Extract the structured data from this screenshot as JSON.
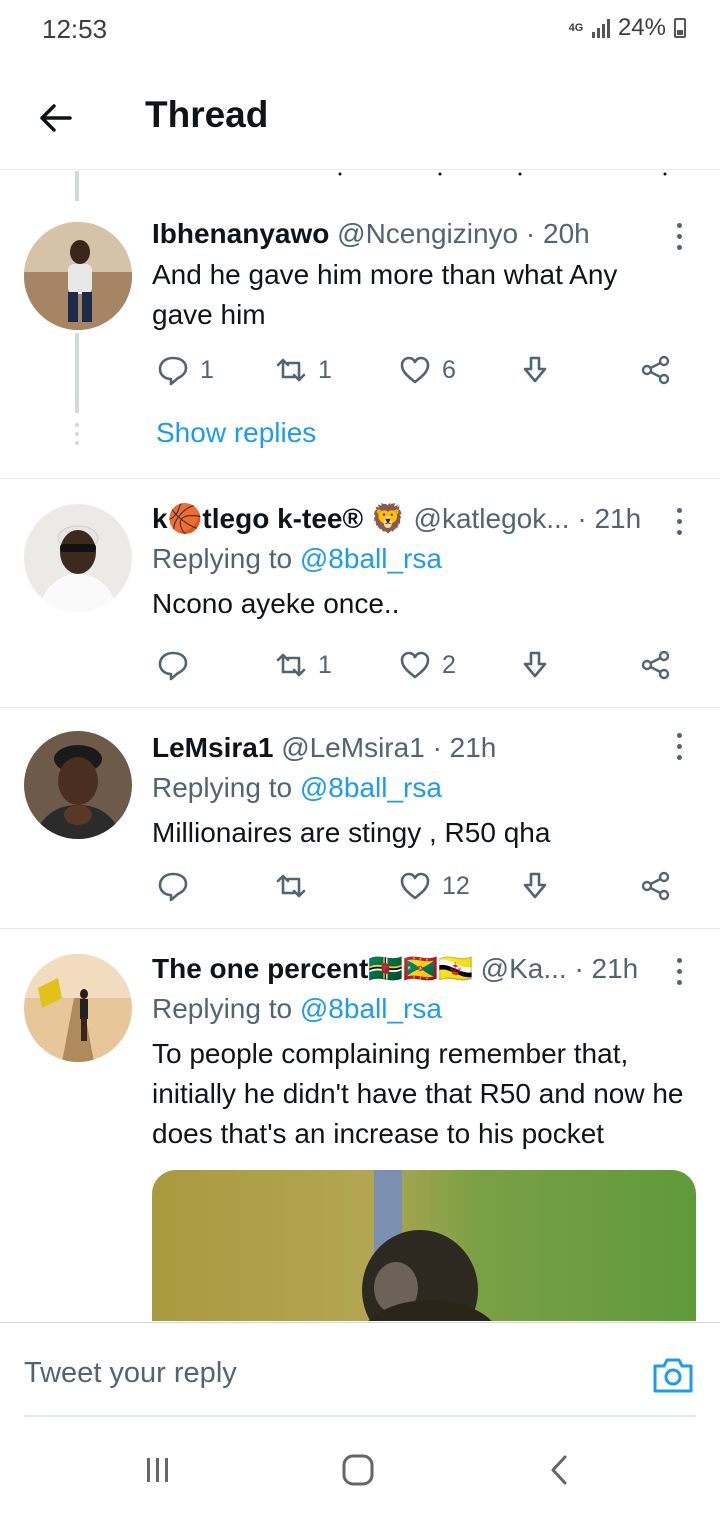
{
  "status_bar": {
    "time": "12:53",
    "network": "4G",
    "battery": "24%"
  },
  "header": {
    "title": "Thread"
  },
  "tweets": [
    {
      "name": "Ibhenanyawo",
      "handle": "@Ncengizinyo",
      "time": "· 20h",
      "replying_prefix": "",
      "replying_to": "",
      "text": "And he gave him more than what Any gave him",
      "replies": "1",
      "retweets": "1",
      "likes": "6",
      "show_replies": "Show replies"
    },
    {
      "name": "k🏀tlego k-tee® 🦁",
      "handle": "@katlegok...",
      "time": "· 21h",
      "replying_prefix": "Replying to",
      "replying_to": "@8ball_rsa",
      "text": "Ncono ayeke once..",
      "replies": "",
      "retweets": "1",
      "likes": "2"
    },
    {
      "name": "LeMsira1",
      "handle": "@LeMsira1",
      "time": "· 21h",
      "replying_prefix": "Replying to",
      "replying_to": "@8ball_rsa",
      "text": "Millionaires are stingy , R50 qha",
      "replies": "",
      "retweets": "",
      "likes": "12"
    },
    {
      "name": "The one percent🇩🇲🇬🇩🇧🇳",
      "handle": "@Ka...",
      "time": "· 21h",
      "replying_prefix": "Replying to",
      "replying_to": "@8ball_rsa",
      "text": "To people complaining remember that, initially he didn't have that R50 and now he does that's an increase to his pocket"
    }
  ],
  "reply_bar": {
    "placeholder": "Tweet your reply"
  },
  "colors": {
    "accent": "#1d9bf0",
    "text": "#0f1419",
    "secondary": "#536471",
    "divider": "#e6ecf0"
  },
  "icons": [
    "back-arrow-icon",
    "more-vertical-icon",
    "reply-icon",
    "retweet-icon",
    "like-icon",
    "download-icon",
    "share-icon",
    "camera-icon",
    "recents-icon",
    "home-icon",
    "back-icon"
  ]
}
